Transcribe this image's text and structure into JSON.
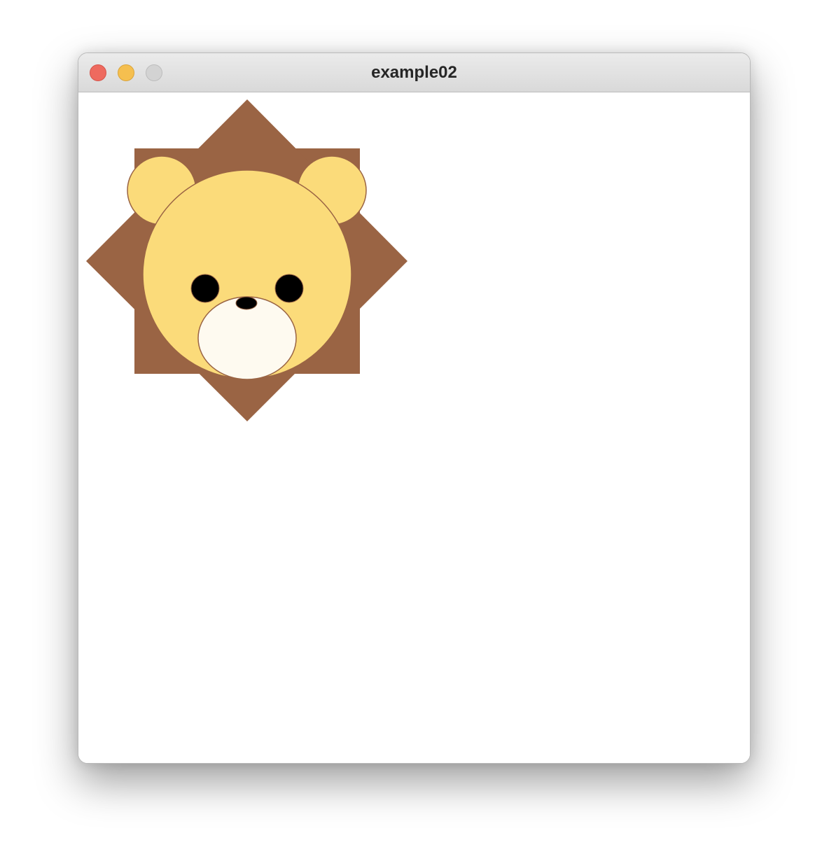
{
  "window": {
    "title": "example02"
  },
  "traffic_lights": {
    "close": {
      "fill": "#ee6a5f",
      "stroke": "#d5544a"
    },
    "minimize": {
      "fill": "#f5bf4f",
      "stroke": "#d9a43c"
    },
    "zoom": {
      "fill": "#d3d3d3",
      "stroke": "#bcbcbc"
    }
  },
  "colors": {
    "mane": "#9a6444",
    "face": "#fbdb7a",
    "face_outline": "#9a6444",
    "muzzle": "#fefaf0",
    "eyes": "#000000",
    "nose": "#000000",
    "canvas_background": "#ffffff"
  }
}
